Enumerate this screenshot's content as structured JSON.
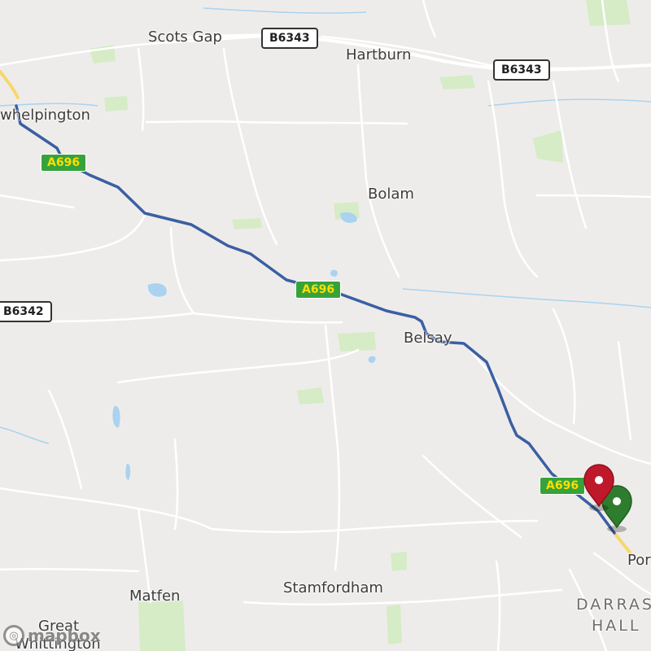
{
  "map": {
    "places": [
      {
        "name": "Scots Gap",
        "slug": "scots-gap"
      },
      {
        "name": "Hartburn",
        "slug": "hartburn"
      },
      {
        "name": "whelpington",
        "slug": "whelpington"
      },
      {
        "name": "Bolam",
        "slug": "bolam"
      },
      {
        "name": "Belsay",
        "slug": "belsay"
      },
      {
        "name": "Matfen",
        "slug": "matfen"
      },
      {
        "name": "Stamfordham",
        "slug": "stamfordham"
      },
      {
        "name": "Great",
        "slug": "great"
      },
      {
        "name": "Whittington",
        "slug": "whittington"
      },
      {
        "name": "Por",
        "slug": "por"
      },
      {
        "name": "DARRAS",
        "slug": "darras"
      },
      {
        "name": "HALL",
        "slug": "hall"
      }
    ],
    "road_shields": [
      {
        "ref": "B6343",
        "type": "b-road"
      },
      {
        "ref": "B6343",
        "type": "b-road"
      },
      {
        "ref": "B6342",
        "type": "b-road"
      },
      {
        "ref": "A696",
        "type": "a-road"
      },
      {
        "ref": "A696",
        "type": "a-road"
      },
      {
        "ref": "A696",
        "type": "a-road"
      }
    ],
    "route": {
      "color": "#3a5fa3",
      "line_style": "solid"
    },
    "markers": [
      {
        "name": "start",
        "color": "#2e7d2e",
        "icon": "map-pin-icon"
      },
      {
        "name": "end",
        "color": "#c0182b",
        "icon": "map-pin-icon"
      }
    ],
    "attribution": {
      "text": "mapbox",
      "icon": "mapbox-logo-icon"
    },
    "colors": {
      "land": "#eeecea",
      "road": "#ffffff",
      "water": "#a9d3f0",
      "park": "#d5ecc6",
      "major_road": "#f6d86b"
    }
  }
}
